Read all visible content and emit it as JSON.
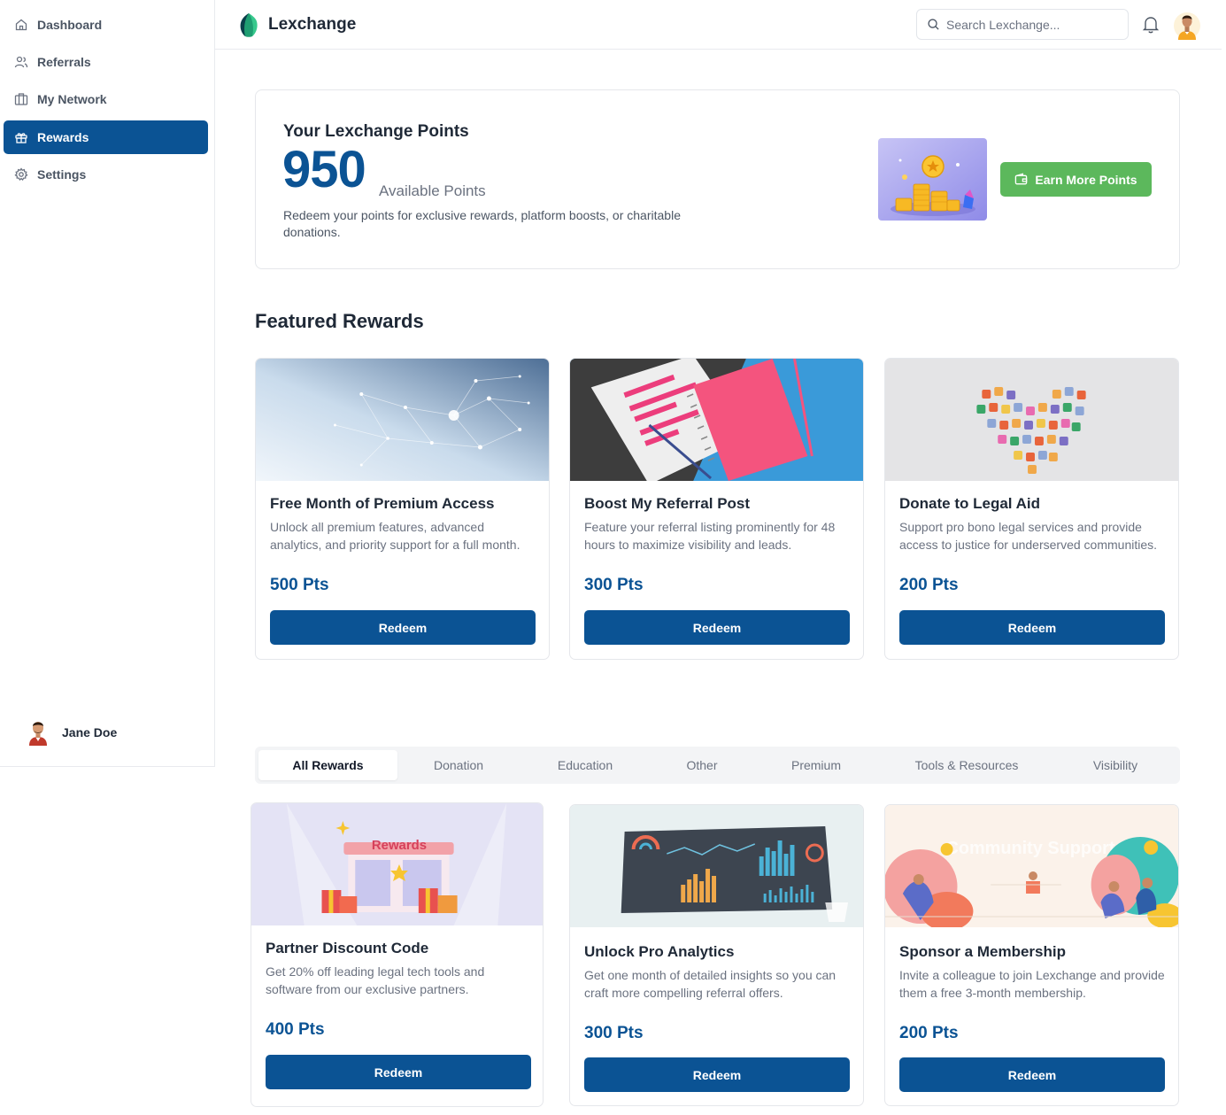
{
  "app": {
    "name": "Lexchange"
  },
  "sidebar": {
    "items": [
      {
        "label": "Dashboard",
        "icon": "home-icon"
      },
      {
        "label": "Referrals",
        "icon": "users-icon"
      },
      {
        "label": "My Network",
        "icon": "network-icon"
      },
      {
        "label": "Rewards",
        "icon": "gift-icon",
        "active": true
      },
      {
        "label": "Settings",
        "icon": "gear-icon"
      }
    ],
    "user": {
      "name": "Jane Doe"
    }
  },
  "header": {
    "search_placeholder": "Search Lexchange..."
  },
  "points": {
    "title": "Your Lexchange Points",
    "value": "950",
    "label": "Available Points",
    "description": "Redeem your points for exclusive rewards, platform boosts, or charitable donations.",
    "earn_button": "Earn More Points"
  },
  "featured": {
    "title": "Featured Rewards",
    "cards": [
      {
        "title": "Free Month of Premium Access",
        "description": "Unlock all premium features, advanced analytics, and priority support for a full month.",
        "points": "500 Pts",
        "button": "Redeem"
      },
      {
        "title": "Boost My Referral Post",
        "description": "Feature your referral listing prominently for 48 hours to maximize visibility and leads.",
        "points": "300 Pts",
        "button": "Redeem"
      },
      {
        "title": "Donate to Legal Aid",
        "description": "Support pro bono legal services and provide access to justice for underserved communities.",
        "points": "200 Pts",
        "button": "Redeem"
      }
    ]
  },
  "tabs": [
    "All Rewards",
    "Donation",
    "Education",
    "Other",
    "Premium",
    "Tools & Resources",
    "Visibility"
  ],
  "rewards": [
    {
      "title": "Partner Discount Code",
      "description": "Get 20% off leading legal tech tools and software from our exclusive partners.",
      "points": "400 Pts",
      "button": "Redeem",
      "image_text": "Rewards"
    },
    {
      "title": "Unlock Pro Analytics",
      "description": "Get one month of detailed insights so you can craft more compelling referral offers.",
      "points": "300 Pts",
      "button": "Redeem"
    },
    {
      "title": "Sponsor a Membership",
      "description": "Invite a colleague to join Lexchange and provide them a free 3-month membership.",
      "points": "200 Pts",
      "button": "Redeem",
      "image_text": "Community Support"
    }
  ],
  "colors": {
    "primary": "#0b5394",
    "success": "#5cb85c"
  }
}
